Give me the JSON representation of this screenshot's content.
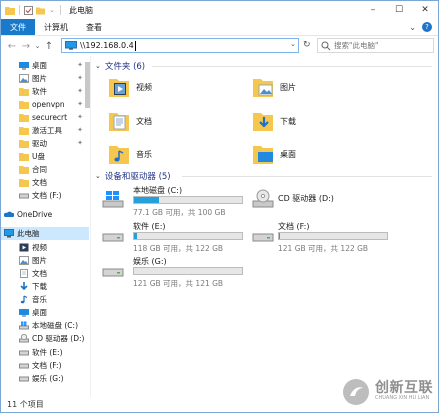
{
  "window": {
    "title": "此电脑",
    "controls": {
      "minimize": "–",
      "maximize": "☐",
      "close": "✕"
    }
  },
  "ribbon": {
    "tabs": [
      {
        "label": "文件",
        "active": true
      },
      {
        "label": "计算机"
      },
      {
        "label": "查看"
      }
    ],
    "expand": "⌄",
    "help": "?"
  },
  "nav_buttons": {
    "back": "←",
    "forward": "→",
    "dropdown": "⌄",
    "up": "↑"
  },
  "address": {
    "value": "\\\\192.168.0.4",
    "dropdown": "⌄",
    "refresh": "↻"
  },
  "search": {
    "placeholder": "搜索\"此电脑\""
  },
  "sidebar": {
    "items": [
      {
        "label": "桌面",
        "icon": "desktop-icon",
        "pinned": true
      },
      {
        "label": "图片",
        "icon": "pictures-folder-icon",
        "pinned": true
      },
      {
        "label": "软件",
        "icon": "folder-icon",
        "pinned": true
      },
      {
        "label": "openvpn",
        "icon": "folder-icon",
        "pinned": true
      },
      {
        "label": "securecrt",
        "icon": "folder-icon",
        "pinned": true
      },
      {
        "label": "激活工具",
        "icon": "folder-icon",
        "pinned": true
      },
      {
        "label": "驱动",
        "icon": "folder-icon",
        "pinned": true
      },
      {
        "label": "U盘",
        "icon": "folder-icon"
      },
      {
        "label": "合同",
        "icon": "folder-icon"
      },
      {
        "label": "文档",
        "icon": "folder-icon"
      },
      {
        "label": "文档 (F:)",
        "icon": "drive-icon"
      },
      {
        "label": "OneDrive",
        "icon": "onedrive-icon"
      },
      {
        "label": "此电脑",
        "icon": "this-pc-icon",
        "selected": true
      },
      {
        "label": "视频",
        "icon": "videos-folder-icon"
      },
      {
        "label": "图片",
        "icon": "pictures-folder-icon"
      },
      {
        "label": "文档",
        "icon": "documents-folder-icon"
      },
      {
        "label": "下载",
        "icon": "downloads-icon"
      },
      {
        "label": "音乐",
        "icon": "music-icon"
      },
      {
        "label": "桌面",
        "icon": "desktop-icon"
      },
      {
        "label": "本地磁盘 (C:)",
        "icon": "windows-drive-icon"
      },
      {
        "label": "CD 驱动器 (D:)",
        "icon": "cd-drive-icon"
      },
      {
        "label": "软件 (E:)",
        "icon": "drive-icon"
      },
      {
        "label": "文档 (F:)",
        "icon": "drive-icon"
      },
      {
        "label": "娱乐 (G:)",
        "icon": "drive-icon"
      }
    ]
  },
  "folders_group": {
    "header": "文件夹 (6)",
    "items": [
      {
        "label": "视频",
        "icon": "videos-folder-icon"
      },
      {
        "label": "图片",
        "icon": "pictures-folder-icon"
      },
      {
        "label": "文档",
        "icon": "documents-folder-icon"
      },
      {
        "label": "下载",
        "icon": "downloads-folder-icon"
      },
      {
        "label": "音乐",
        "icon": "music-folder-icon"
      },
      {
        "label": "桌面",
        "icon": "desktop-folder-icon"
      }
    ]
  },
  "drives_group": {
    "header": "设备和驱动器 (5)",
    "drives": [
      {
        "label": "本地磁盘 (C:)",
        "free": "77.1 GB 可用，共 100 GB",
        "used_fraction": 0.23,
        "icon": "windows-drive-icon"
      },
      {
        "label": "CD 驱动器 (D:)",
        "icon": "cd-drive-icon"
      },
      {
        "label": "软件 (E:)",
        "free": "118 GB 可用，共 122 GB",
        "used_fraction": 0.03,
        "icon": "drive-icon"
      },
      {
        "label": "文档 (F:)",
        "free": "121 GB 可用，共 122 GB",
        "used_fraction": 0.01,
        "icon": "drive-icon"
      },
      {
        "label": "娱乐 (G:)",
        "free": "121 GB 可用，共 121 GB",
        "used_fraction": 0.0,
        "icon": "drive-icon"
      }
    ]
  },
  "status": {
    "count": "11 个项目"
  },
  "watermark": {
    "brand": "创新互联",
    "sub": "CHUANG XIN HU LIAN"
  },
  "colors": {
    "accent": "#1979ca",
    "selection": "#cce8ff",
    "bar_fill": "#26a0da",
    "folder": "#f5c74f",
    "header_text": "#1e3287"
  }
}
